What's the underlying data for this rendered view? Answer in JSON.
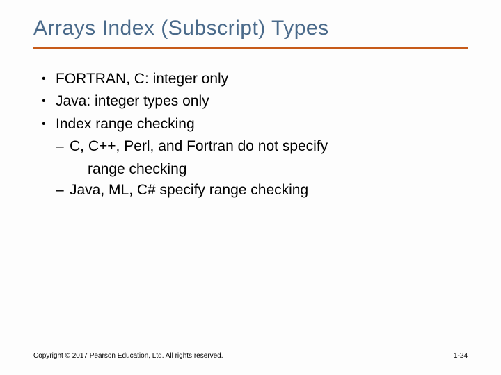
{
  "title": "Arrays Index (Subscript) Types",
  "bullets": {
    "b0": "FORTRAN, C: integer only",
    "b1": "Java: integer types only",
    "b2": "Index range checking",
    "s0a": "C, C++, Perl, and Fortran do not specify",
    "s0b": "range checking",
    "s1": "Java, ML, C# specify range checking"
  },
  "footer": {
    "copyright": "Copyright © 2017 Pearson Education, Ltd. All rights reserved.",
    "page": "1-24"
  }
}
